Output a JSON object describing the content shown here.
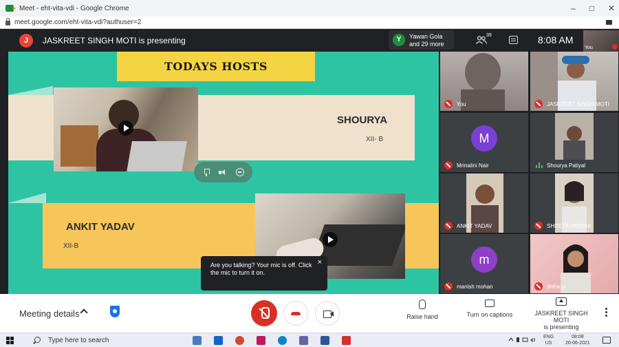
{
  "browser": {
    "tab_title": "Meet - eht-vita-vdi - Google Chrome",
    "url": "meet.google.com/eht-vita-vdi?authuser=2",
    "controls": [
      "–",
      "□",
      "✕"
    ]
  },
  "meet": {
    "presenter_initial": "J",
    "presenter_text": "JASKREET SINGH MOTI is presenting",
    "viewer_initial": "Y",
    "viewer_line1": "Yawan Gola",
    "viewer_line2": "and 29 more",
    "people_count": "39",
    "time": "8:08 AM",
    "self_label": "You"
  },
  "slide": {
    "heading": "TODAYS HOSTS",
    "host1_name": "SHOURYA",
    "host1_class": "XII- B",
    "host2_name": "ANKIT YADAV",
    "host2_class": "XII-B"
  },
  "mic_tooltip": {
    "text": "Are you talking? Your mic is off. Click the mic to turn it on.",
    "close": "×"
  },
  "participants": [
    {
      "name": "You",
      "muted": true
    },
    {
      "name": "JASKREET SINGH MOTI",
      "muted": true
    },
    {
      "name": "Mrinalini Nair",
      "muted": true,
      "initial": "M"
    },
    {
      "name": "Shourya Patiyal",
      "muted": false
    },
    {
      "name": "ANKIT YADAV",
      "muted": true
    },
    {
      "name": "SHREYA PATHAK",
      "muted": true
    },
    {
      "name": "manish mohan",
      "muted": true,
      "initial": "m"
    },
    {
      "name": "disha xi",
      "muted": true
    }
  ],
  "bottom": {
    "meeting_details": "Meeting details",
    "raise_hand": "Raise hand",
    "captions": "Turn on captions",
    "presenting_line1": "JASKREET SINGH MOTI",
    "presenting_line2": "is presenting"
  },
  "taskbar": {
    "search_placeholder": "Type here to search",
    "lang_line1": "ENG",
    "lang_line2": "US",
    "time": "08:08",
    "date": "20-06-2021"
  }
}
